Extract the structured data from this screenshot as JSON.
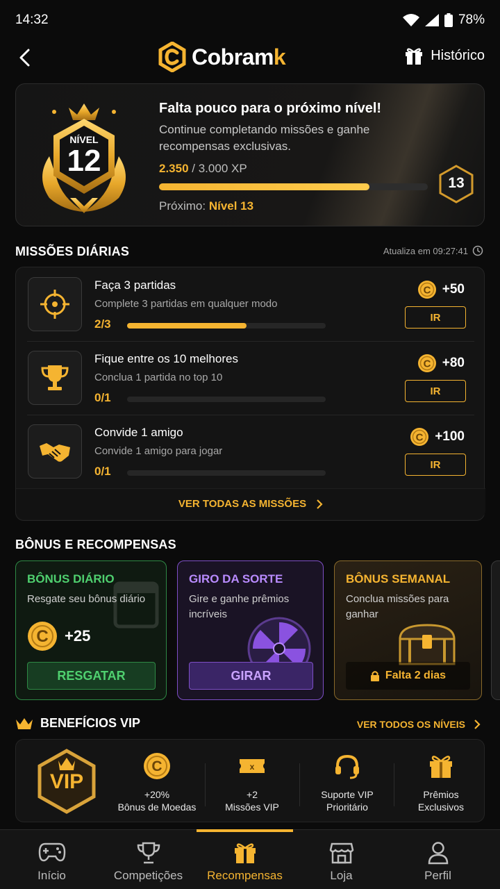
{
  "status_bar": {
    "time": "14:32",
    "battery": "78%"
  },
  "header": {
    "logo_main": "Cobram",
    "logo_accent": "k",
    "history_label": "Histórico"
  },
  "level_card": {
    "badge_label": "NÍVEL",
    "level": "12",
    "title": "Falta pouco para o próximo nível!",
    "description": "Continue completando missões e ganhe recompensas exclusivas.",
    "xp_current": "2.350",
    "xp_total": "/ 3.000 XP",
    "xp_progress": 0.783,
    "next_prefix": "Próximo:",
    "next_level_text": "Nível 13",
    "next_level_number": "13"
  },
  "missions": {
    "title": "MISSÕES DIÁRIAS",
    "refresh_text": "Atualiza em 09:27:41",
    "see_all": "VER TODAS AS MISSÕES",
    "items": [
      {
        "icon": "crosshair-icon",
        "title": "Faça 3 partidas",
        "description": "Complete 3 partidas em qualquer modo",
        "progress_text": "2/3",
        "progress": 0.6,
        "reward": "+50",
        "button": "IR"
      },
      {
        "icon": "trophy-icon",
        "title": "Fique entre os 10 melhores",
        "description": "Conclua 1 partida no top 10",
        "progress_text": "0/1",
        "progress": 0,
        "reward": "+80",
        "button": "IR"
      },
      {
        "icon": "handshake-icon",
        "title": "Convide 1 amigo",
        "description": "Convide 1 amigo para jogar",
        "progress_text": "0/1",
        "progress": 0,
        "reward": "+100",
        "button": "IR"
      }
    ]
  },
  "bonus": {
    "title": "BÔNUS E RECOMPENSAS",
    "daily": {
      "title": "BÔNUS DIÁRIO",
      "description": "Resgate seu bônus diário",
      "amount": "+25",
      "button": "RESGATAR"
    },
    "spin": {
      "title": "GIRO DA SORTE",
      "description_1": "Gire e ganhe prêmios",
      "description_2": "incríveis",
      "button": "GIRAR"
    },
    "weekly": {
      "title": "BÔNUS SEMANAL",
      "description_1": "Conclua missões para",
      "description_2": "ganhar",
      "status": "Falta 2 dias"
    }
  },
  "vip": {
    "title": "BENEFÍCIOS VIP",
    "see_all": "VER TODOS OS NÍVEIS",
    "badge_text": "VIP",
    "perks": [
      {
        "icon": "coin-icon",
        "line1": "+20%",
        "line2": "Bônus de Moedas"
      },
      {
        "icon": "ticket-icon",
        "line1": "+2",
        "line2": "Missões VIP"
      },
      {
        "icon": "headset-icon",
        "line1": "Suporte VIP",
        "line2": "Prioritário"
      },
      {
        "icon": "gift-icon",
        "line1": "Prêmios",
        "line2": "Exclusivos"
      }
    ]
  },
  "nav": [
    {
      "icon": "gamepad-icon",
      "label": "Início"
    },
    {
      "icon": "trophy-icon",
      "label": "Competições"
    },
    {
      "icon": "gift-icon",
      "label": "Recompensas",
      "active": true
    },
    {
      "icon": "store-icon",
      "label": "Loja"
    },
    {
      "icon": "user-icon",
      "label": "Perfil"
    }
  ],
  "colors": {
    "accent": "#f5b431",
    "green": "#2e8a45",
    "purple": "#7e4fc7",
    "background": "#0b0b0b"
  }
}
